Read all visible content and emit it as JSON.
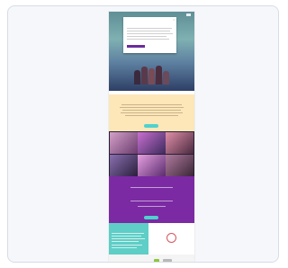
{
  "site": {
    "logo": "",
    "hero": {
      "dialog": {
        "title": "",
        "text": "",
        "button": ""
      },
      "heading_items": [
        "",
        "",
        ""
      ]
    },
    "yellow": {
      "title": "",
      "text": "",
      "cta": ""
    },
    "grid": {
      "captions": [
        "",
        "",
        "",
        "",
        "",
        ""
      ]
    },
    "purple": {
      "title": "",
      "subtitle": "",
      "cta": ""
    },
    "teal": {
      "title": ""
    },
    "promo": {
      "badge_text": ""
    },
    "footer": {
      "brand": ""
    }
  },
  "colors": {
    "purple": "#7b2aa3",
    "yellow": "#fde6b8",
    "teal": "#5ecec6",
    "accent": "#4fd2cf"
  }
}
